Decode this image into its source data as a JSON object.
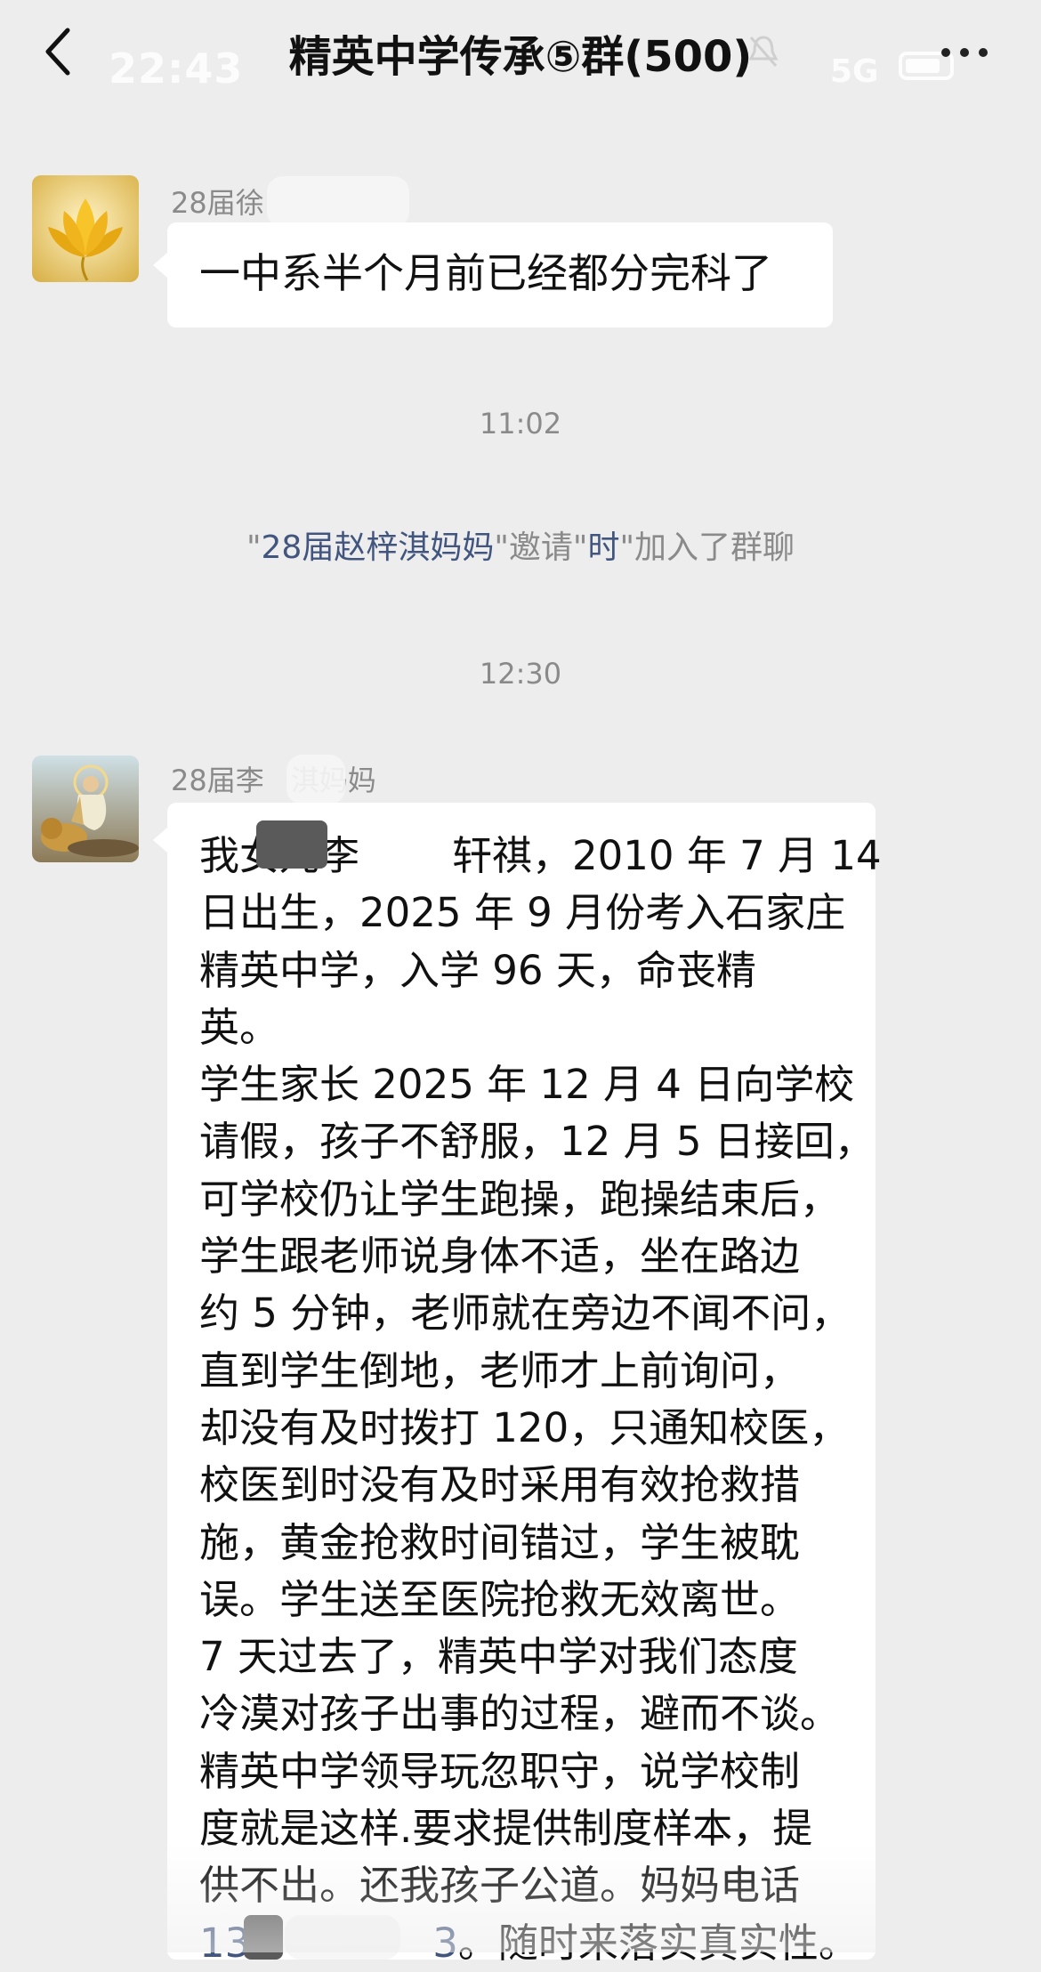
{
  "status_bar": {
    "time": "22:43",
    "network": "5G"
  },
  "header": {
    "title": "精英中学传承⑤群(500)"
  },
  "messages": [
    {
      "sender": "28届徐",
      "text": "一中系半个月前已经都分完科了"
    }
  ],
  "timestamps": [
    "11:02",
    "12:30"
  ],
  "system_notice": {
    "q1": "\"",
    "inviter": "28届赵梓淇妈妈",
    "q2": "\"邀请\"",
    "invitee": "时",
    "q3": "\"加入了群聊"
  },
  "message2": {
    "sender_a": "28届李",
    "sender_b": "淇妈妈",
    "lines": [
      "我女儿李",
      "日出生，2025 年 9 月份考入石家庄",
      "精英中学，入学 96 天，命丧精",
      "英。",
      "学生家长 2025 年 12 月 4 日向学校",
      "请假，孩子不舒服，12 月 5 日接回，",
      "可学校仍让学生跑操，跑操结束后，",
      "学生跟老师说身体不适，坐在路边",
      "约 5 分钟，老师就在旁边不闻不问，",
      "直到学生倒地，老师才上前询问，",
      "却没有及时拨打 120，只通知校医，",
      "校医到时没有及时采用有效抢救措",
      "施，黄金抢救时间错过，学生被耽",
      "误。学生送至医院抢救无效离世。",
      "7 天过去了，精英中学对我们态度",
      "冷漠对孩子出事的过程，避而不谈。",
      "精英中学领导玩忽职守，说学校制",
      "度就是这样.要求提供制度样本，提",
      "供不出。还我孩子公道。妈妈电话"
    ],
    "line1_tail": "轩祺，2010 年 7 月 14",
    "phone_prefix": "13",
    "phone_mid": "3",
    "last_tail": "。随时来落实真实性。"
  },
  "icons": [
    "back-chevron-icon",
    "bell-off-icon",
    "more-icon",
    "lotus-avatar-icon",
    "guanyin-avatar-icon"
  ]
}
